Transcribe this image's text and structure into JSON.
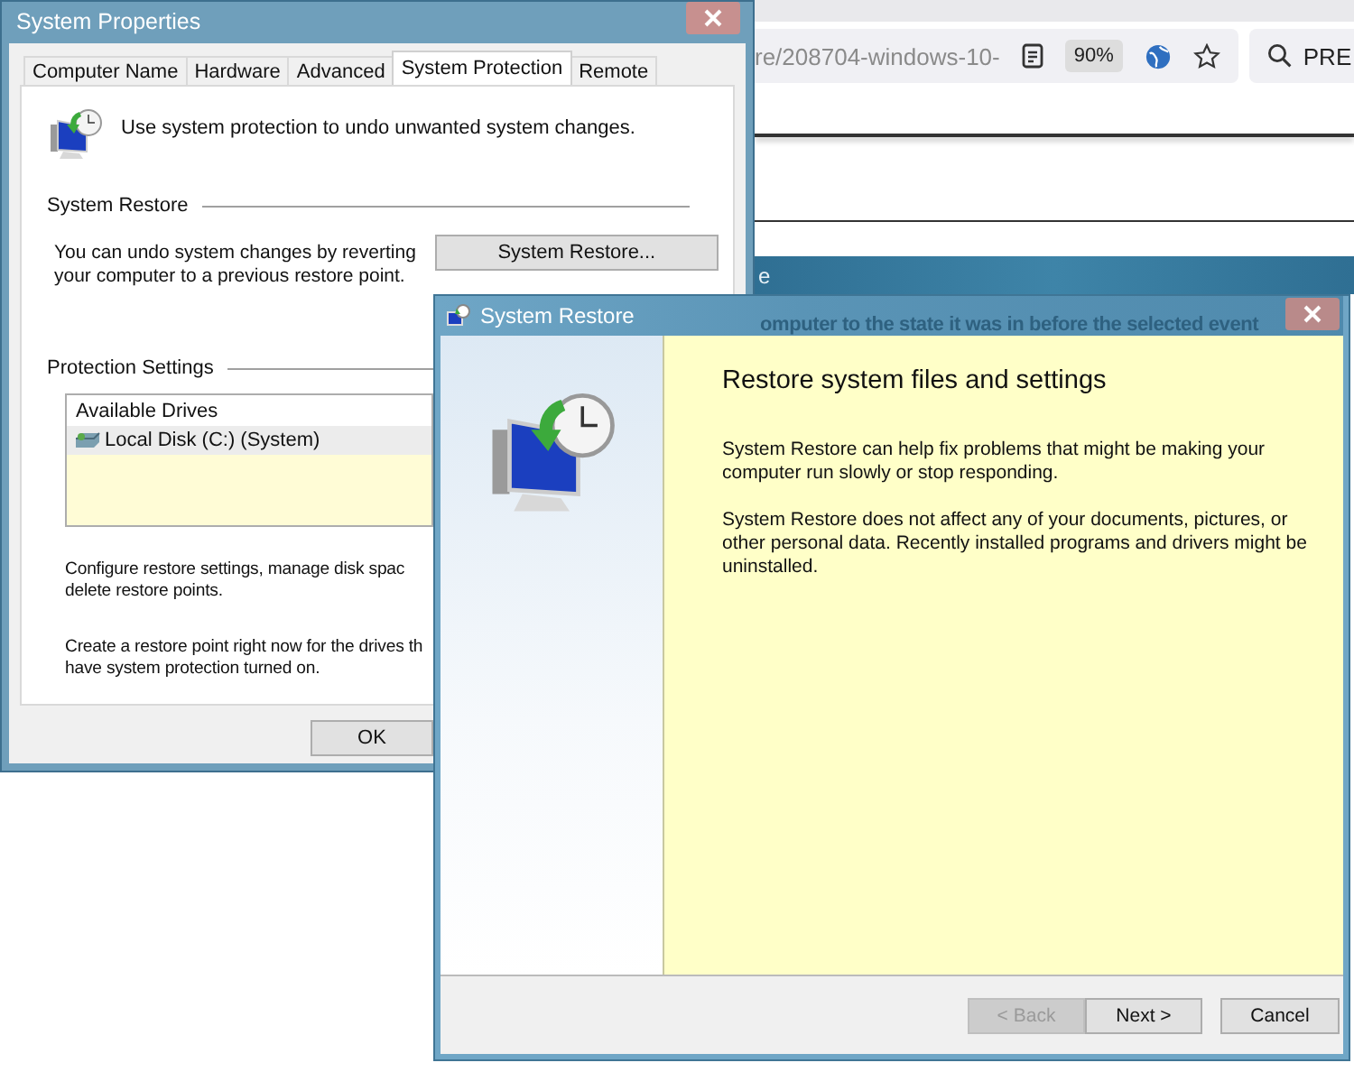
{
  "browser": {
    "address": "re/208704-windows-10-",
    "zoom": "90%",
    "search": "PRE"
  },
  "background_window": {
    "title": "e",
    "text": "omputer to the state it was in before the selected event"
  },
  "system_properties": {
    "title": "System Properties",
    "tabs": [
      {
        "label": "Computer Name",
        "selected": false
      },
      {
        "label": "Hardware",
        "selected": false
      },
      {
        "label": "Advanced",
        "selected": false
      },
      {
        "label": "System Protection",
        "selected": true
      },
      {
        "label": "Remote",
        "selected": false
      }
    ],
    "intro": "Use system protection to undo unwanted system changes.",
    "restore_section": {
      "heading": "System Restore",
      "text": "You can undo system changes by reverting your computer to a previous restore point.",
      "button": "System Restore..."
    },
    "protection_section": {
      "heading": "Protection Settings",
      "list": {
        "columns": [
          "Available Drives"
        ],
        "rows": [
          {
            "name": "Local Disk (C:) (System)",
            "selected": true
          }
        ]
      },
      "configure_text": [
        "Configure restore settings, manage disk spac",
        "delete restore points."
      ],
      "create_text": [
        "Create a restore point right now for the drives th",
        "have system protection turned on."
      ]
    },
    "buttons": [
      "OK"
    ]
  },
  "system_restore": {
    "title": "System Restore",
    "heading": "Restore system files and settings",
    "paragraphs": [
      "System Restore can help fix problems that might be making your computer run slowly or stop responding.",
      "System Restore does not affect any of your documents, pictures, or other personal data. Recently installed programs and drivers might be uninstalled."
    ],
    "buttons": [
      {
        "label": "< Back",
        "disabled": true
      },
      {
        "label": "Next >",
        "disabled": false
      },
      {
        "label": "Cancel",
        "disabled": false
      }
    ]
  }
}
